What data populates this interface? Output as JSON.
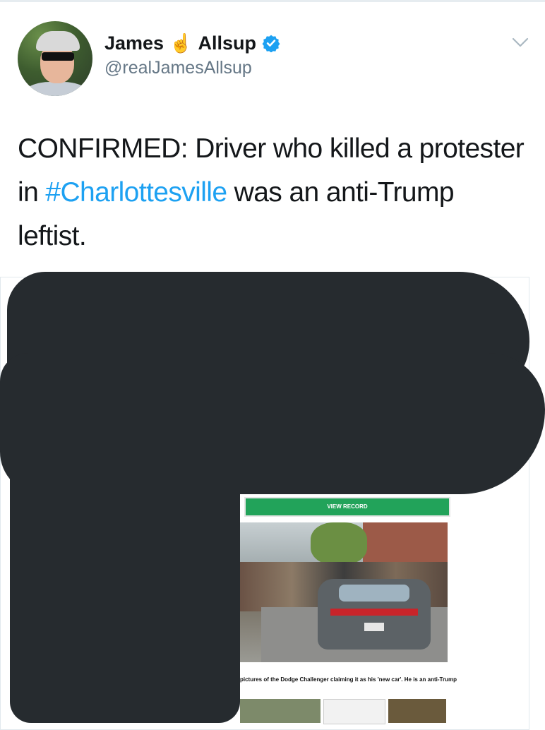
{
  "tweet": {
    "display_name_first": "James",
    "display_name_emoji": "☝",
    "display_name_last": "Allsup",
    "handle": "@realJamesAllsup",
    "text_before": "CONFIRMED: Driver who killed a protester in ",
    "hashtag": "#Charlottesville",
    "text_after": " was an anti-Trump leftist."
  },
  "icons": {
    "verified": "verified-badge-icon",
    "menu": "chevron-down-icon"
  },
  "media": {
    "view_record_label": "VIEW RECORD",
    "caption": "pictures of the Dodge Challenger claiming it as his 'new car'. He is an anti-Trump"
  },
  "colors": {
    "hashtag": "#1da1f2",
    "verified": "#1da1f2",
    "redaction": "#262b2f",
    "view_record": "#22a35a"
  }
}
